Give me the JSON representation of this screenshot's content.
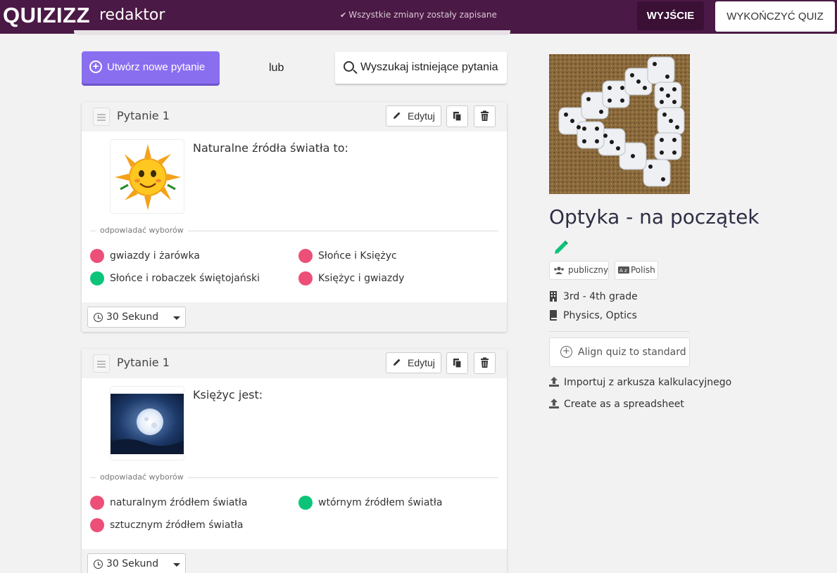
{
  "topbar": {
    "logo": "QUIZIZZ",
    "editor_label": "redaktor",
    "save_status": "Wszystkie zmiany zostały zapisane",
    "exit_label": "WYJŚCIE",
    "finish_label": "WYKOŃCZYĆ QUIZ"
  },
  "actions": {
    "create_label": "Utwórz nowe pytanie",
    "or_label": "lub",
    "search_label": "Wyszukaj istniejące pytania"
  },
  "questions": [
    {
      "title": "Pytanie 1",
      "edit_label": "Edytuj",
      "text": "Naturalne źródła światła to:",
      "image_icon": "sun-image",
      "choices_label": "odpowiadać wyborów",
      "answers": [
        {
          "text": "gwiazdy i żarówka",
          "correct": false
        },
        {
          "text": "Słońce i Księżyc",
          "correct": false
        },
        {
          "text": "Słońce i robaczek świętojański",
          "correct": true
        },
        {
          "text": "Księżyc i gwiazdy",
          "correct": false
        }
      ],
      "timer": "30 Sekund"
    },
    {
      "title": "Pytanie 1",
      "edit_label": "Edytuj",
      "text": "Księżyc jest:",
      "image_icon": "moon-image",
      "choices_label": "odpowiadać wyborów",
      "answers": [
        {
          "text": "naturalnym źródłem światła",
          "correct": false
        },
        {
          "text": "wtórnym źródłem światła",
          "correct": true
        },
        {
          "text": "sztucznym źródłem światła",
          "correct": false
        }
      ],
      "timer": "30 Sekund"
    }
  ],
  "quiz": {
    "cover_icon": "dice-image",
    "title": "Optyka - na początek",
    "visibility": "publiczny",
    "language": "Polish",
    "grade": "3rd - 4th grade",
    "subjects": "Physics, Optics",
    "align_label": "Align quiz to standard",
    "import_label": "Importuj z arkusza kalkulacyjnego",
    "create_sheet_label": "Create as a spreadsheet"
  },
  "colors": {
    "topbar": "#4b1945",
    "primary": "#8a6ef0",
    "correct": "#0cc479",
    "wrong": "#ec4f77"
  }
}
